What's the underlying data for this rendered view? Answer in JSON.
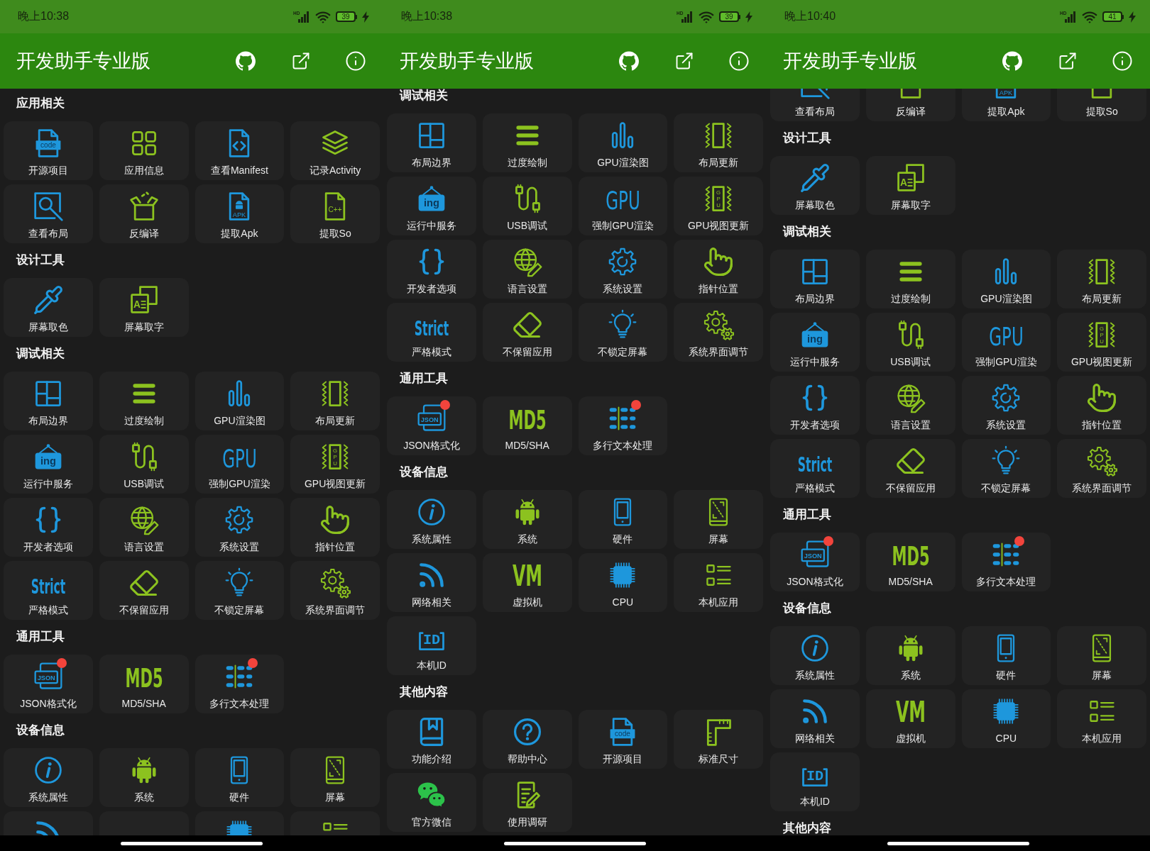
{
  "panels": [
    {
      "status_bar": {
        "time": "晚上10:38",
        "signal_label": "HD",
        "battery": "39"
      },
      "app_bar": {
        "title": "开发助手专业版"
      },
      "sections": [
        {
          "title": "应用相关",
          "items": [
            {
              "label": "开源项目",
              "kind": "code",
              "icon_text": "code"
            },
            {
              "label": "应用信息",
              "kind": "apps"
            },
            {
              "label": "查看Manifest",
              "kind": "manifest"
            },
            {
              "label": "记录Activity",
              "kind": "layers"
            },
            {
              "label": "查看布局",
              "kind": "inspect"
            },
            {
              "label": "反编译",
              "kind": "decompile"
            },
            {
              "label": "提取Apk",
              "kind": "apk",
              "icon_text": "APK"
            },
            {
              "label": "提取So",
              "kind": "cpp",
              "icon_text": "C++"
            }
          ]
        },
        {
          "title": "设计工具",
          "items": [
            {
              "label": "屏幕取色",
              "kind": "picker"
            },
            {
              "label": "屏幕取字",
              "kind": "ocr",
              "icon_text": "A"
            }
          ]
        },
        {
          "title": "调试相关",
          "items": [
            {
              "label": "布局边界",
              "kind": "bounds"
            },
            {
              "label": "过度绘制",
              "kind": "overdraw"
            },
            {
              "label": "GPU渲染图",
              "kind": "bars"
            },
            {
              "label": "布局更新",
              "kind": "updates"
            },
            {
              "label": "运行中服务",
              "kind": "service",
              "icon_text": "ing"
            },
            {
              "label": "USB调试",
              "kind": "usb"
            },
            {
              "label": "强制GPU渲染",
              "kind": "gpu",
              "icon_text": "GPU"
            },
            {
              "label": "GPU视图更新",
              "kind": "gpuview",
              "icon_text": "GPU"
            },
            {
              "label": "开发者选项",
              "kind": "braces"
            },
            {
              "label": "语言设置",
              "kind": "globe"
            },
            {
              "label": "系统设置",
              "kind": "gear"
            },
            {
              "label": "指针位置",
              "kind": "pointer"
            },
            {
              "label": "严格模式",
              "kind": "strict",
              "icon_text": "Strict"
            },
            {
              "label": "不保留应用",
              "kind": "eraser"
            },
            {
              "label": "不锁定屏幕",
              "kind": "bulb"
            },
            {
              "label": "系统界面调节",
              "kind": "gears"
            }
          ]
        },
        {
          "title": "通用工具",
          "items": [
            {
              "label": "JSON格式化",
              "kind": "json",
              "icon_text": "JSON",
              "dot": true
            },
            {
              "label": "MD5/SHA",
              "kind": "md5",
              "icon_text": "MD5",
              "dot": false
            },
            {
              "label": "多行文本处理",
              "kind": "lines",
              "dot": true
            }
          ]
        },
        {
          "title": "设备信息",
          "items": [
            {
              "label": "系统属性",
              "kind": "info"
            },
            {
              "label": "系统",
              "kind": "android"
            },
            {
              "label": "硬件",
              "kind": "phone"
            },
            {
              "label": "屏幕",
              "kind": "screen"
            },
            {
              "kind": "wifi"
            },
            {
              "kind": "vm"
            },
            {
              "kind": "chip"
            },
            {
              "kind": "list"
            }
          ]
        }
      ]
    },
    {
      "status_bar": {
        "time": "晚上10:38",
        "signal_label": "HD",
        "battery": "39"
      },
      "app_bar": {
        "title": "开发助手专业版"
      },
      "sections": [
        {
          "title": "调试相关",
          "items": [
            {
              "label": "布局边界",
              "kind": "bounds"
            },
            {
              "label": "过度绘制",
              "kind": "overdraw"
            },
            {
              "label": "GPU渲染图",
              "kind": "bars"
            },
            {
              "label": "布局更新",
              "kind": "updates"
            },
            {
              "label": "运行中服务",
              "kind": "service",
              "icon_text": "ing"
            },
            {
              "label": "USB调试",
              "kind": "usb"
            },
            {
              "label": "强制GPU渲染",
              "kind": "gpu",
              "icon_text": "GPU"
            },
            {
              "label": "GPU视图更新",
              "kind": "gpuview",
              "icon_text": "GPU"
            },
            {
              "label": "开发者选项",
              "kind": "braces"
            },
            {
              "label": "语言设置",
              "kind": "globe"
            },
            {
              "label": "系统设置",
              "kind": "gear"
            },
            {
              "label": "指针位置",
              "kind": "pointer"
            },
            {
              "label": "严格模式",
              "kind": "strict",
              "icon_text": "Strict"
            },
            {
              "label": "不保留应用",
              "kind": "eraser"
            },
            {
              "label": "不锁定屏幕",
              "kind": "bulb"
            },
            {
              "label": "系统界面调节",
              "kind": "gears"
            }
          ]
        },
        {
          "title": "通用工具",
          "items": [
            {
              "label": "JSON格式化",
              "kind": "json",
              "icon_text": "JSON",
              "dot": true
            },
            {
              "label": "MD5/SHA",
              "kind": "md5",
              "icon_text": "MD5",
              "dot": false
            },
            {
              "label": "多行文本处理",
              "kind": "lines",
              "dot": true
            }
          ]
        },
        {
          "title": "设备信息",
          "items": [
            {
              "label": "系统属性",
              "kind": "info"
            },
            {
              "label": "系统",
              "kind": "android"
            },
            {
              "label": "硬件",
              "kind": "phone"
            },
            {
              "label": "屏幕",
              "kind": "screen"
            },
            {
              "label": "网络相关",
              "kind": "wifi"
            },
            {
              "label": "虚拟机",
              "kind": "vm",
              "icon_text": "VM"
            },
            {
              "label": "CPU",
              "kind": "chip"
            },
            {
              "label": "本机应用",
              "kind": "list"
            },
            {
              "label": "本机ID",
              "kind": "id",
              "icon_text": "ID"
            }
          ]
        },
        {
          "title": "其他内容",
          "items": [
            {
              "label": "功能介绍",
              "kind": "book"
            },
            {
              "label": "帮助中心",
              "kind": "help"
            },
            {
              "label": "开源项目",
              "kind": "code",
              "icon_text": "code"
            },
            {
              "label": "标准尺寸",
              "kind": "ruler"
            },
            {
              "label": "官方微信",
              "kind": "chat"
            },
            {
              "label": "使用调研",
              "kind": "survey"
            }
          ]
        }
      ]
    },
    {
      "status_bar": {
        "time": "晚上10:40",
        "signal_label": "HD",
        "battery": "41"
      },
      "app_bar": {
        "title": "开发助手专业版"
      },
      "sections": [
        {
          "items": [
            {
              "label": "查看布局",
              "kind": "inspect"
            },
            {
              "label": "反编译",
              "kind": "decompile"
            },
            {
              "label": "提取Apk",
              "kind": "apk",
              "icon_text": "APK"
            },
            {
              "label": "提取So",
              "kind": "cpp"
            }
          ]
        },
        {
          "title": "设计工具",
          "items": [
            {
              "label": "屏幕取色",
              "kind": "picker"
            },
            {
              "label": "屏幕取字",
              "kind": "ocr",
              "icon_text": "A"
            }
          ]
        },
        {
          "title": "调试相关",
          "items": [
            {
              "label": "布局边界",
              "kind": "bounds"
            },
            {
              "label": "过度绘制",
              "kind": "overdraw"
            },
            {
              "label": "GPU渲染图",
              "kind": "bars"
            },
            {
              "label": "布局更新",
              "kind": "updates"
            },
            {
              "label": "运行中服务",
              "kind": "service",
              "icon_text": "ing"
            },
            {
              "label": "USB调试",
              "kind": "usb"
            },
            {
              "label": "强制GPU渲染",
              "kind": "gpu",
              "icon_text": "GPU"
            },
            {
              "label": "GPU视图更新",
              "kind": "gpuview",
              "icon_text": "GPU"
            },
            {
              "label": "开发者选项",
              "kind": "braces"
            },
            {
              "label": "语言设置",
              "kind": "globe"
            },
            {
              "label": "系统设置",
              "kind": "gear"
            },
            {
              "label": "指针位置",
              "kind": "pointer"
            },
            {
              "label": "严格模式",
              "kind": "strict",
              "icon_text": "Strict"
            },
            {
              "label": "不保留应用",
              "kind": "eraser"
            },
            {
              "label": "不锁定屏幕",
              "kind": "bulb"
            },
            {
              "label": "系统界面调节",
              "kind": "gears"
            }
          ]
        },
        {
          "title": "通用工具",
          "items": [
            {
              "label": "JSON格式化",
              "kind": "json",
              "icon_text": "JSON",
              "dot": true
            },
            {
              "label": "MD5/SHA",
              "kind": "md5",
              "icon_text": "MD5",
              "dot": false
            },
            {
              "label": "多行文本处理",
              "kind": "lines",
              "dot": true
            }
          ]
        },
        {
          "title": "设备信息",
          "items": [
            {
              "label": "系统属性",
              "kind": "info"
            },
            {
              "label": "系统",
              "kind": "android"
            },
            {
              "label": "硬件",
              "kind": "phone"
            },
            {
              "label": "屏幕",
              "kind": "screen"
            },
            {
              "label": "网络相关",
              "kind": "wifi"
            },
            {
              "label": "虚拟机",
              "kind": "vm",
              "icon_text": "VM"
            },
            {
              "label": "CPU",
              "kind": "chip"
            },
            {
              "label": "本机应用",
              "kind": "list"
            },
            {
              "label": "本机ID",
              "kind": "id",
              "icon_text": "ID"
            }
          ]
        },
        {
          "title": "其他内容"
        }
      ]
    }
  ]
}
